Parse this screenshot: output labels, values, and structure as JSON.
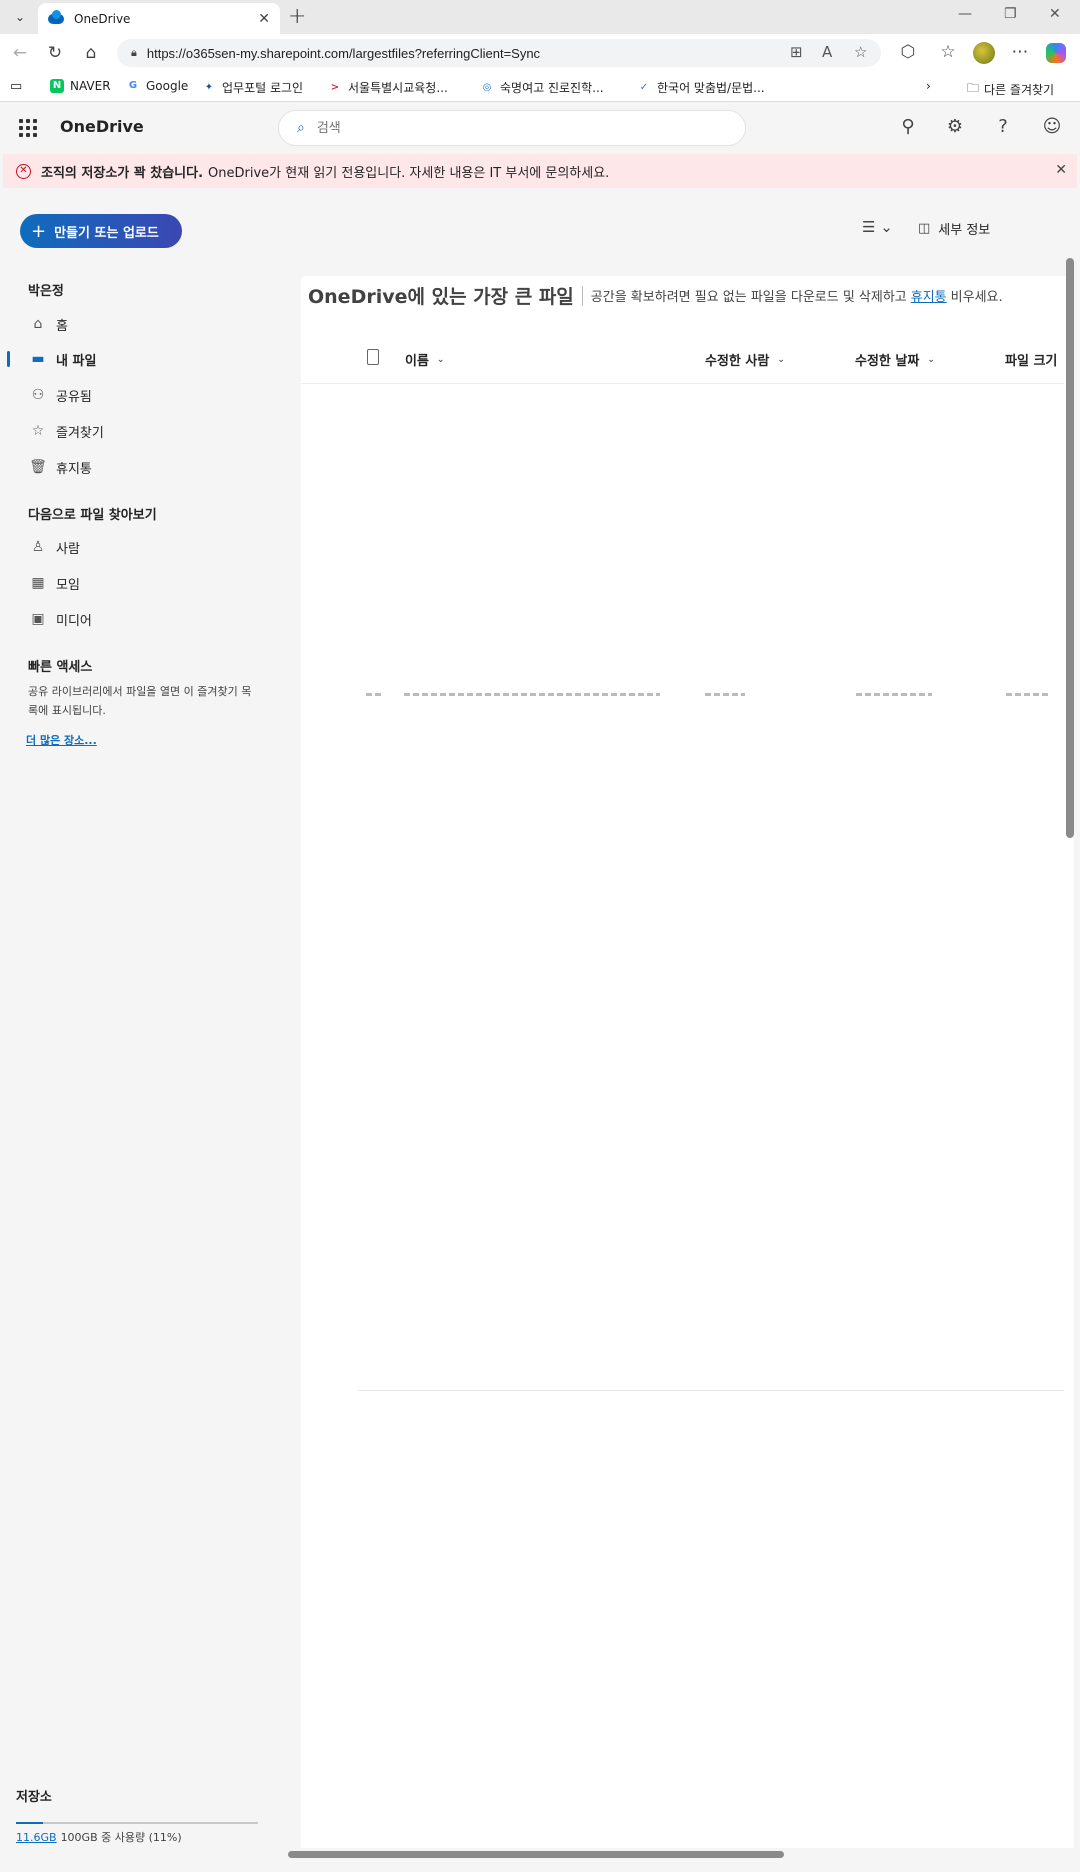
{
  "browser": {
    "tab_title": "OneDrive",
    "url": "https://o365sen-my.sharepoint.com/largestfiles?referringClient=Sync",
    "bookmarks": [
      {
        "label": "NAVER",
        "color": "#03c75a",
        "glyph": "N"
      },
      {
        "label": "Google",
        "color": "#4285f4",
        "glyph": "G"
      },
      {
        "label": "업무포털 로그인",
        "color": "#1e4fa3",
        "glyph": "✦"
      },
      {
        "label": "서울특별시교육청...",
        "color": "#e0282e",
        "glyph": ">"
      },
      {
        "label": "숙명여고 진로진학...",
        "color": "#2b7bd4",
        "glyph": "◎"
      },
      {
        "label": "한국어 맞춤법/문법...",
        "color": "#2f6fe0",
        "glyph": "✓"
      }
    ],
    "other_favorites": "다른 즐겨찾기"
  },
  "app": {
    "name": "OneDrive",
    "search_placeholder": "검색"
  },
  "banner": {
    "bold": "조직의 저장소가 꽉 찼습니다.",
    "message": "OneDrive가 현재 읽기 전용입니다. 자세한 내용은 IT 부서에 문의하세요."
  },
  "nav": {
    "create_label": "만들기 또는 업로드",
    "user_name": "박은정",
    "items": [
      {
        "label": "홈"
      },
      {
        "label": "내 파일"
      },
      {
        "label": "공유됨"
      },
      {
        "label": "즐겨찾기"
      },
      {
        "label": "휴지통"
      }
    ],
    "browse_title": "다음으로 파일 찾아보기",
    "browse_items": [
      {
        "label": "사람"
      },
      {
        "label": "모임"
      },
      {
        "label": "미디어"
      }
    ],
    "quick_access_title": "빠른 액세스",
    "quick_access_desc": "공유 라이브러리에서 파일을 열면 이 즐겨찾기 목록에 표시됩니다.",
    "more_places": "더 많은 장소..."
  },
  "storage": {
    "title": "저장소",
    "used_link": "11.6GB",
    "used_text": "100GB 중 사용량 (11%)",
    "used_fraction": 0.11
  },
  "main": {
    "details_label": "세부 정보",
    "heading": "OneDrive에 있는 가장 큰 파일",
    "subtext_before": "공간을 확보하려면 필요 없는 파일을 다운로드 및 삭제하고",
    "subtext_link": "휴지통",
    "subtext_after": "비우세요.",
    "columns": {
      "name": "이름",
      "modified_by": "수정한 사람",
      "modified_date": "수정한 날짜",
      "file_size": "파일 크기"
    }
  },
  "colors": {
    "accent": "#0f6cbd",
    "error": "#c50f1f",
    "banner_bg": "#fde7e9"
  }
}
